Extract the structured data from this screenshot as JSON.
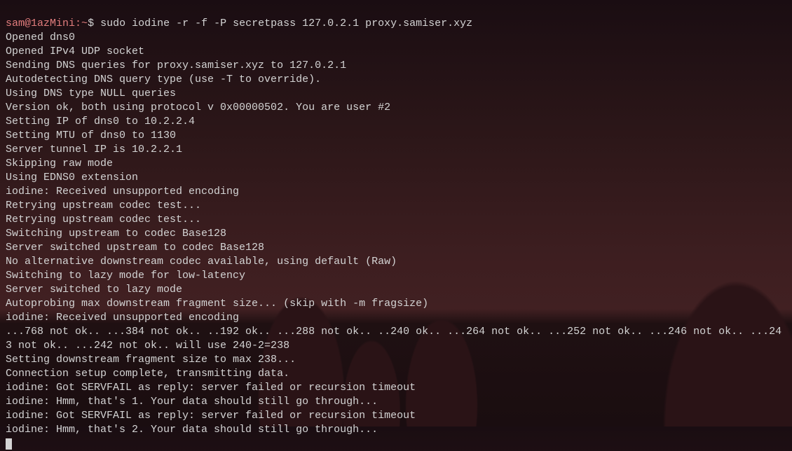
{
  "prompt": {
    "user_host": "sam@1azMini",
    "separator": ":",
    "path": "~",
    "dollar": "$ "
  },
  "command": "sudo iodine -r -f -P secretpass 127.0.2.1 proxy.samiser.xyz",
  "output": [
    "Opened dns0",
    "Opened IPv4 UDP socket",
    "Sending DNS queries for proxy.samiser.xyz to 127.0.2.1",
    "Autodetecting DNS query type (use -T to override).",
    "Using DNS type NULL queries",
    "Version ok, both using protocol v 0x00000502. You are user #2",
    "Setting IP of dns0 to 10.2.2.4",
    "Setting MTU of dns0 to 1130",
    "Server tunnel IP is 10.2.2.1",
    "Skipping raw mode",
    "Using EDNS0 extension",
    "iodine: Received unsupported encoding",
    "Retrying upstream codec test...",
    "Retrying upstream codec test...",
    "Switching upstream to codec Base128",
    "Server switched upstream to codec Base128",
    "No alternative downstream codec available, using default (Raw)",
    "Switching to lazy mode for low-latency",
    "Server switched to lazy mode",
    "Autoprobing max downstream fragment size... (skip with -m fragsize)",
    "iodine: Received unsupported encoding",
    "...768 not ok.. ...384 not ok.. ..192 ok.. ...288 not ok.. ..240 ok.. ...264 not ok.. ...252 not ok.. ...246 not ok.. ...243 not ok.. ...242 not ok.. will use 240-2=238",
    "Setting downstream fragment size to max 238...",
    "Connection setup complete, transmitting data.",
    "iodine: Got SERVFAIL as reply: server failed or recursion timeout",
    "iodine: Hmm, that's 1. Your data should still go through...",
    "iodine: Got SERVFAIL as reply: server failed or recursion timeout",
    "iodine: Hmm, that's 2. Your data should still go through..."
  ]
}
